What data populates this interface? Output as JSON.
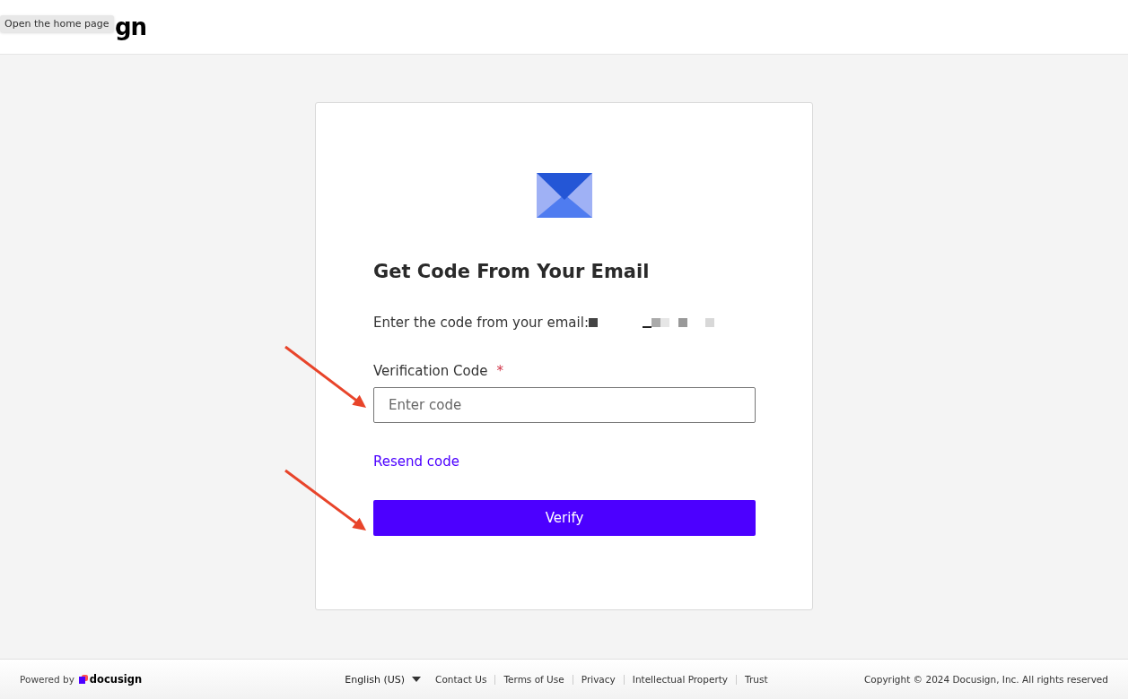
{
  "header": {
    "logo_text": "gn",
    "tooltip": "Open the home page"
  },
  "card": {
    "title": "Get Code From Your Email",
    "instruction": "Enter the code from your email:",
    "field_label": "Verification Code",
    "required_mark": "*",
    "placeholder": "Enter code",
    "resend_link": "Resend code",
    "verify_button": "Verify"
  },
  "footer": {
    "powered_by": "Powered by",
    "brand": "docusign",
    "language": "English (US)",
    "links": [
      "Contact Us",
      "Terms of Use",
      "Privacy",
      "Intellectual Property",
      "Trust"
    ],
    "copyright": "Copyright © 2024 Docusign, Inc. All rights reserved"
  }
}
